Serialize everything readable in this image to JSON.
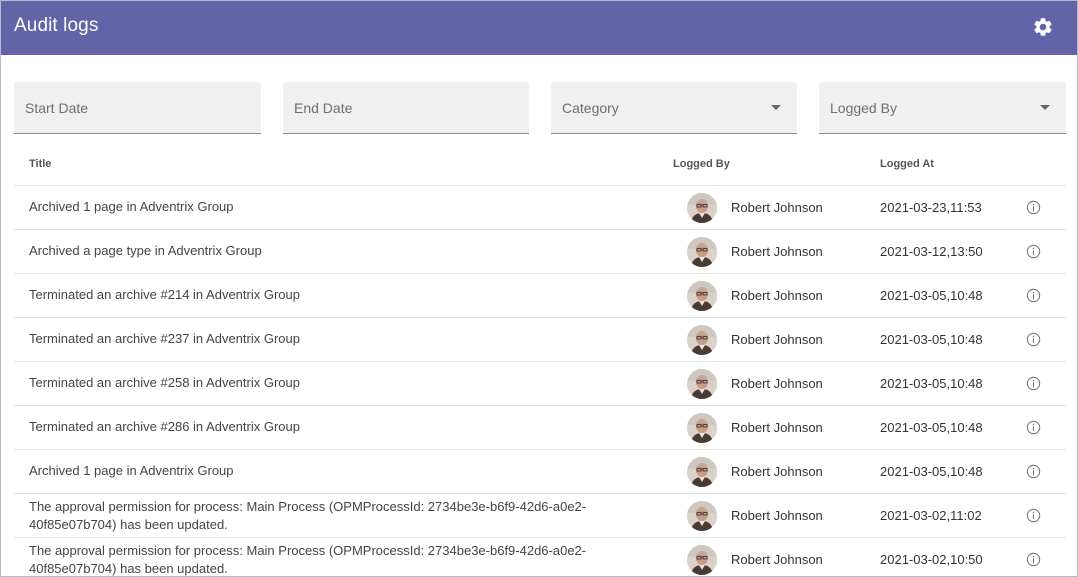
{
  "header": {
    "title": "Audit logs",
    "settings_icon": "gear-icon",
    "color": "#6264a7"
  },
  "filters": {
    "start_date": "Start Date",
    "end_date": "End Date",
    "category": "Category",
    "logged_by": "Logged By"
  },
  "table": {
    "columns": {
      "title": "Title",
      "logged_by": "Logged By",
      "logged_at": "Logged At"
    },
    "rows": [
      {
        "title": "Archived 1 page in Adventrix Group",
        "user": "Robert Johnson",
        "time": "2021-03-23,11:53"
      },
      {
        "title": "Archived a page type in Adventrix Group",
        "user": "Robert Johnson",
        "time": "2021-03-12,13:50"
      },
      {
        "title": "Terminated an archive #214 in Adventrix Group",
        "user": "Robert Johnson",
        "time": "2021-03-05,10:48"
      },
      {
        "title": "Terminated an archive #237 in Adventrix Group",
        "user": "Robert Johnson",
        "time": "2021-03-05,10:48"
      },
      {
        "title": "Terminated an archive #258 in Adventrix Group",
        "user": "Robert Johnson",
        "time": "2021-03-05,10:48"
      },
      {
        "title": "Terminated an archive #286 in Adventrix Group",
        "user": "Robert Johnson",
        "time": "2021-03-05,10:48"
      },
      {
        "title": "Archived 1 page in Adventrix Group",
        "user": "Robert Johnson",
        "time": "2021-03-05,10:48"
      },
      {
        "title": "The approval permission for process: Main Process (OPMProcessId: 2734be3e-b6f9-42d6-a0e2-40f85e07b704) has been updated.",
        "user": "Robert Johnson",
        "time": "2021-03-02,11:02"
      },
      {
        "title": "The approval permission for process: Main Process (OPMProcessId: 2734be3e-b6f9-42d6-a0e2-40f85e07b704) has been updated.",
        "user": "Robert Johnson",
        "time": "2021-03-02,10:50"
      }
    ]
  }
}
